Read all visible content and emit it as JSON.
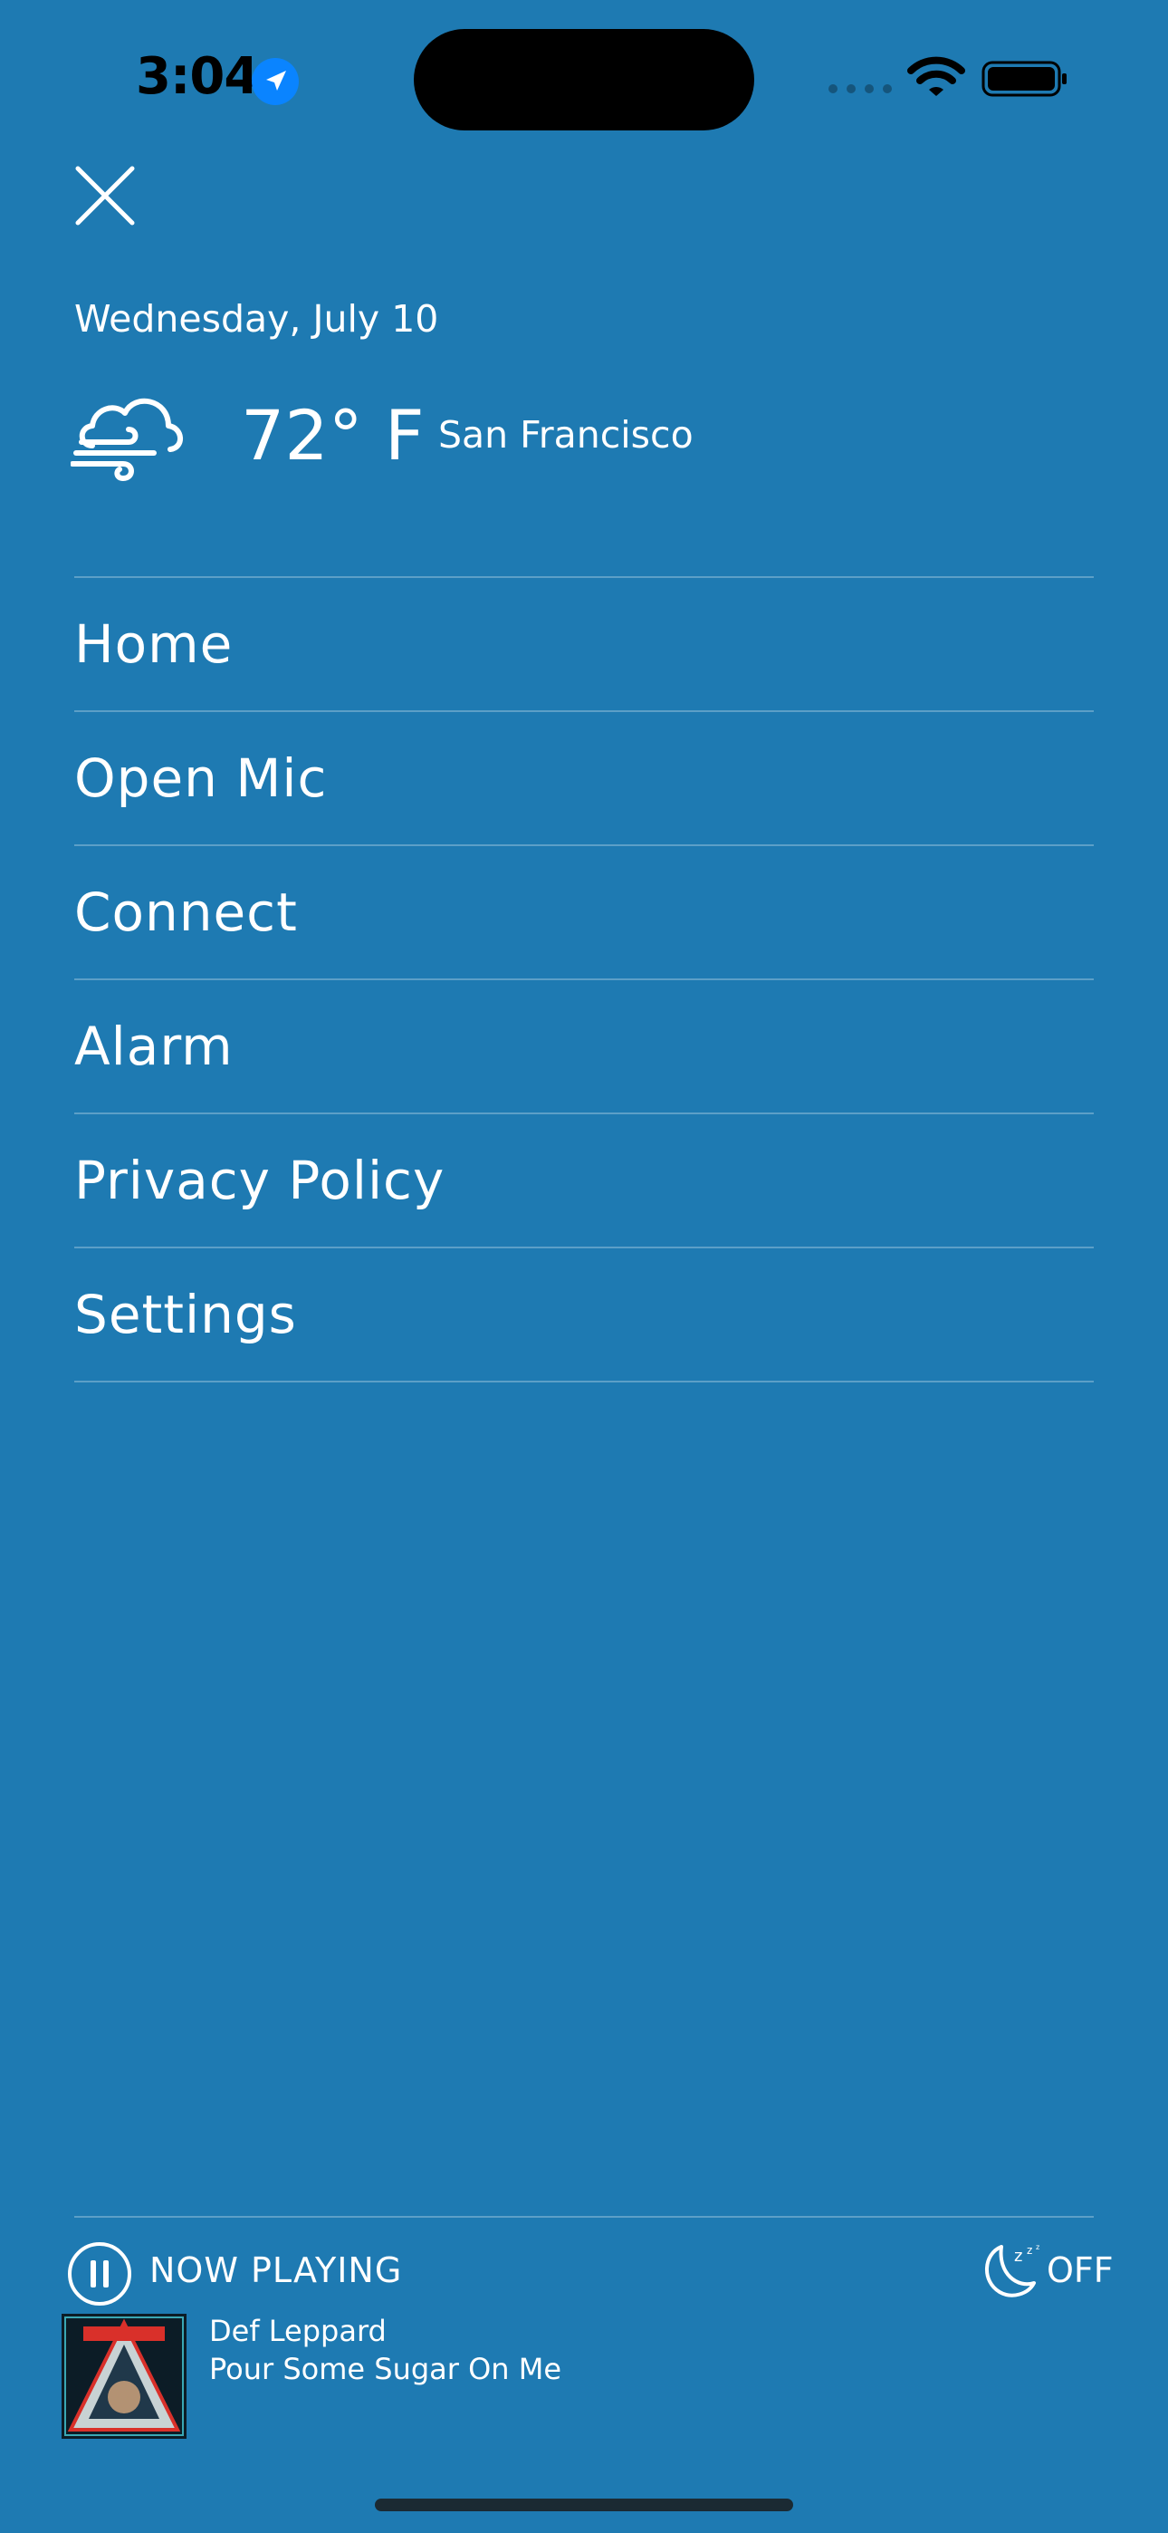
{
  "status_bar": {
    "time": "3:04"
  },
  "header": {
    "close_icon": "close-icon"
  },
  "weather": {
    "date": "Wednesday, July 10",
    "icon": "windy-cloud-icon",
    "temperature": "72° F",
    "city": "San Francisco"
  },
  "menu": {
    "items": [
      {
        "label": "Home"
      },
      {
        "label": "Open Mic"
      },
      {
        "label": "Connect"
      },
      {
        "label": "Alarm"
      },
      {
        "label": "Privacy Policy"
      },
      {
        "label": "Settings"
      }
    ]
  },
  "player": {
    "now_playing_label": "NOW PLAYING",
    "sleep_timer_label": "OFF",
    "artist": "Def Leppard",
    "track": "Pour Some Sugar On Me"
  },
  "colors": {
    "background": "#1e7ab2",
    "text": "#ffffff",
    "location_accent": "#0a84ff"
  }
}
